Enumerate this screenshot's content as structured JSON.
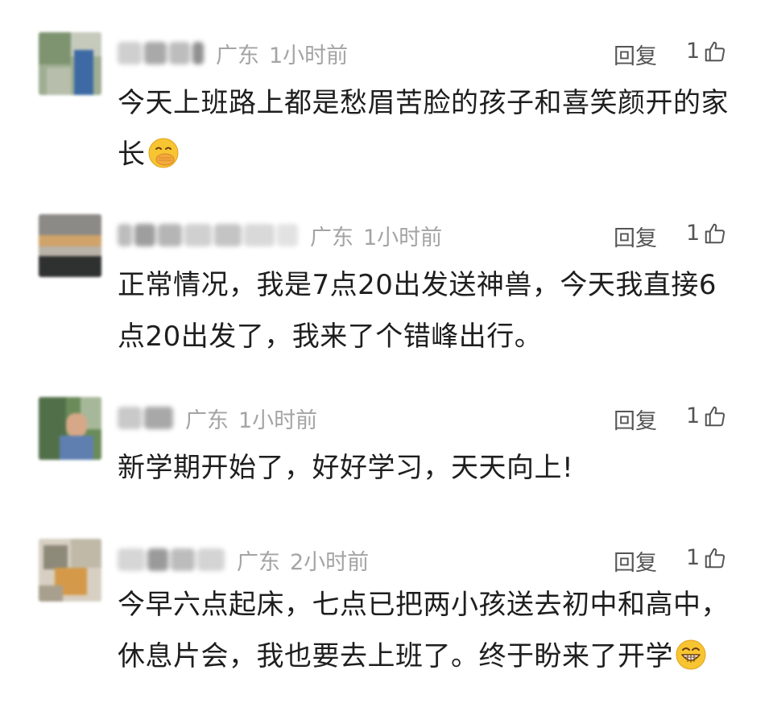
{
  "comments": [
    {
      "location": "广东",
      "time": "1小时前",
      "reply_label": "回复",
      "likes": "1",
      "text": "今天上班路上都是愁眉苦脸的孩子和喜笑颜开的家长",
      "emoji": "hand-over-mouth-emoji"
    },
    {
      "location": "广东",
      "time": "1小时前",
      "reply_label": "回复",
      "likes": "1",
      "text": "正常情况，我是7点20出发送神兽，今天我直接6点20出发了，我来了个错峰出行。"
    },
    {
      "location": "广东",
      "time": "1小时前",
      "reply_label": "回复",
      "likes": "1",
      "text": "新学期开始了，好好学习，天天向上!"
    },
    {
      "location": "广东",
      "time": "2小时前",
      "reply_label": "回复",
      "likes": "1",
      "text": "今早六点起床，七点已把两小孩送去初中和高中，休息片会，我也要去上班了。终于盼来了开学",
      "emoji": "grinning-emoji"
    }
  ],
  "icons": {
    "like": "thumbs-up-icon"
  },
  "colors": {
    "meta_gray": "#a4a4a4",
    "action_gray": "#555555",
    "text": "#1e1e1e",
    "emoji_yellow": "#f7c531"
  }
}
